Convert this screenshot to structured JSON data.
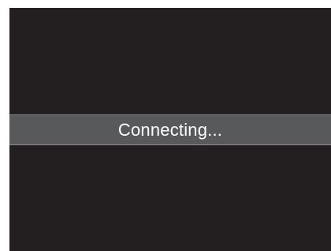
{
  "status": {
    "message": "Connecting..."
  },
  "colors": {
    "screen_background": "#231f20",
    "status_bar_background": "#58595b",
    "status_bar_border": "#8a8b8d",
    "status_text": "#ffffff",
    "outer_margin": "#ffffff"
  }
}
